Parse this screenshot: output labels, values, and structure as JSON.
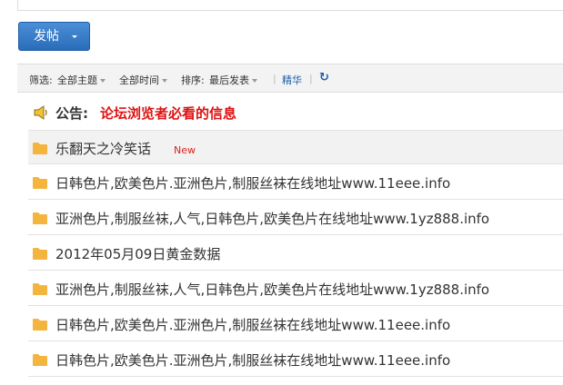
{
  "actions": {
    "post_label": "发帖"
  },
  "filter_bar": {
    "filter_label": "筛选:",
    "topic_filter": "全部主题",
    "time_filter": "全部时间",
    "sort_label": "排序:",
    "sort_value": "最后发表",
    "separator": "|",
    "digest_label": "精华",
    "refresh_glyph": "↻"
  },
  "announcement": {
    "label": "公告:",
    "text": "论坛浏览者必看的信息",
    "icon": "speaker-icon"
  },
  "threads": [
    {
      "title": "乐翻天之冷笑话",
      "badge": "New",
      "icon": "folder-icon"
    },
    {
      "title": "日韩色片,欧美色片.亚洲色片,制服丝袜在线地址www.11eee.info",
      "icon": "folder-icon"
    },
    {
      "title": "亚洲色片,制服丝袜,人气,日韩色片,欧美色片在线地址www.1yz888.info",
      "icon": "folder-icon"
    },
    {
      "title": "2012年05月09日黄金数据",
      "icon": "folder-icon"
    },
    {
      "title": "亚洲色片,制服丝袜,人气,日韩色片,欧美色片在线地址www.1yz888.info",
      "icon": "folder-icon"
    },
    {
      "title": "日韩色片,欧美色片.亚洲色片,制服丝袜在线地址www.11eee.info",
      "icon": "folder-icon"
    },
    {
      "title": "日韩色片,欧美色片.亚洲色片,制服丝袜在线地址www.11eee.info",
      "icon": "folder-icon"
    }
  ],
  "colors": {
    "button": "#2a6cb9",
    "announcement_text": "#dd1111",
    "new_badge": "#e02020",
    "folder": "#f4b53f"
  }
}
